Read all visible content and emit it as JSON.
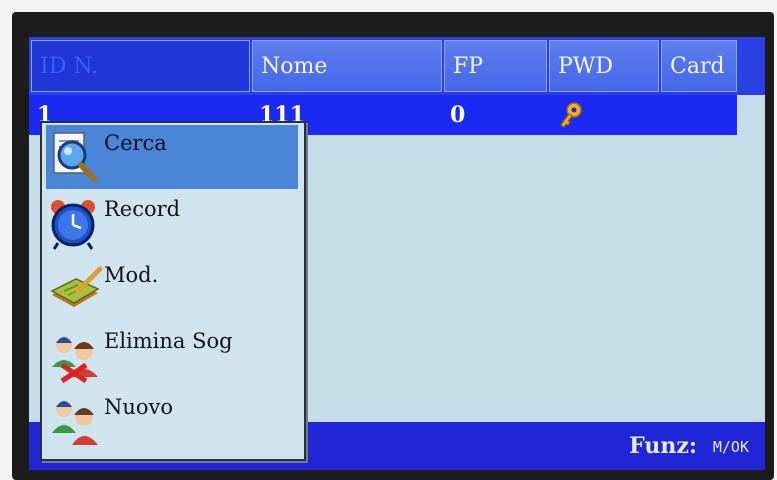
{
  "table": {
    "headers": [
      "ID N.",
      "Nome",
      "FP",
      "PWD",
      "Card"
    ],
    "row": {
      "id": "1",
      "nome": "111",
      "fp": "0",
      "pwd_icon": "key-icon"
    }
  },
  "menu": {
    "items": [
      {
        "label": "Cerca",
        "icon": "search-icon",
        "selected": true
      },
      {
        "label": "Record",
        "icon": "alarm-clock-icon",
        "selected": false
      },
      {
        "label": "Mod.",
        "icon": "edit-icon",
        "selected": false
      },
      {
        "label": "Elimina Sog",
        "icon": "delete-user-icon",
        "selected": false
      },
      {
        "label": "Nuovo",
        "icon": "new-user-icon",
        "selected": false
      }
    ]
  },
  "footer": {
    "label": "Funz:",
    "keys": "M/OK"
  },
  "colors": {
    "header_bg": "#2a40e4",
    "selected_row": "#1a2af2",
    "screen_bg": "#c5dde9",
    "menu_highlight": "#4a85d8"
  }
}
